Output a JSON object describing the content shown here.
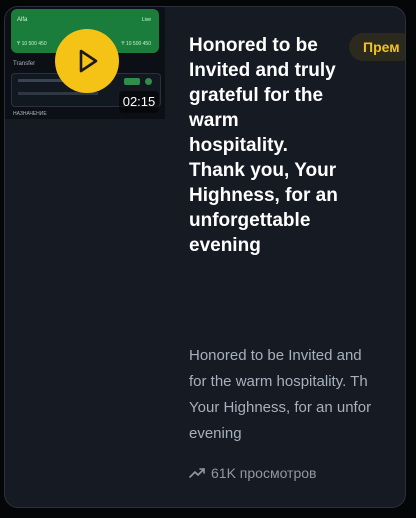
{
  "thumbnail": {
    "top_left": "Alfa",
    "top_right": "Live",
    "top_bottom_left": "₸ 10 500 450",
    "top_bottom_right": "₸ 10 500 450",
    "middle_label": "Transfer",
    "bottom_label": "НАЗНАЧЕНИЕ"
  },
  "card": {
    "duration": "02:15",
    "badge": "Прем",
    "title": "Honored to be Invited and truly grateful for the warm hospitality. Thank you, Your Highness, for an unforgettable evening",
    "description_lines": [
      "Honored to be Invited and",
      "for the warm hospitality. Th",
      "Your Highness, for an unfor",
      "evening"
    ],
    "views": "61K просмотров"
  },
  "colors": {
    "accent": "#f5c316",
    "card_bg": "#151a23",
    "text_primary": "#ffffff",
    "text_secondary": "#a7b0bc"
  },
  "icons": {
    "play": "play-icon",
    "views": "trending-up-icon"
  }
}
